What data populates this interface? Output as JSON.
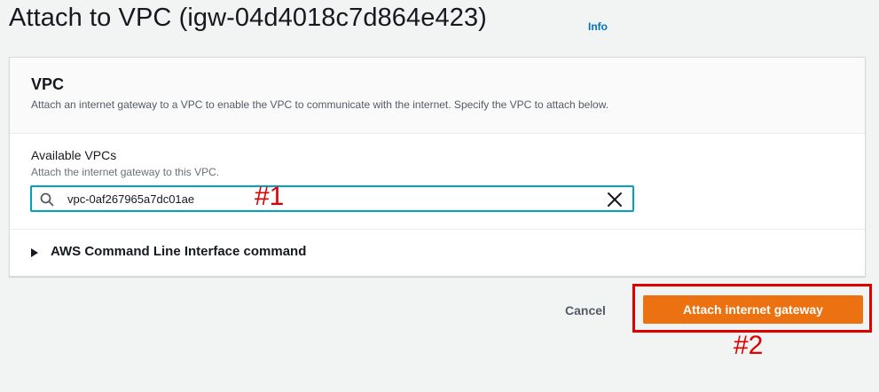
{
  "header": {
    "title": "Attach to VPC (igw-04d4018c7d864e423)",
    "info_link": "Info"
  },
  "vpc_panel": {
    "title": "VPC",
    "description": "Attach an internet gateway to a VPC to enable the VPC to communicate with the internet. Specify the VPC to attach below.",
    "field": {
      "label": "Available VPCs",
      "description": "Attach the internet gateway to this VPC.",
      "value": "vpc-0af267965a7dc01ae"
    },
    "cli_section": {
      "label": "AWS Command Line Interface command",
      "expanded": false
    }
  },
  "actions": {
    "cancel_label": "Cancel",
    "attach_label": "Attach internet gateway"
  },
  "annotations": {
    "marker_1": "#1",
    "marker_2": "#2"
  },
  "icons": {
    "search": "search-icon",
    "clear": "close-icon",
    "expand": "caret-right-icon"
  },
  "colors": {
    "primary_button": "#ec7211",
    "link": "#0073bb",
    "focus_border": "#00a1c9",
    "annotation": "#e00000"
  }
}
